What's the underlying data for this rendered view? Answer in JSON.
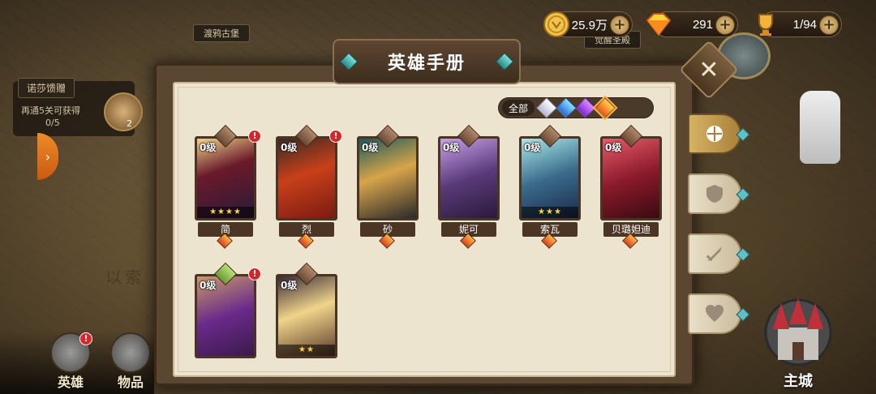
{
  "resources": {
    "gold": "25.9万",
    "gems": "291",
    "stamina": "1/94"
  },
  "map": {
    "location_crow_castle": "渡鸦古堡",
    "location_awaken_temple": "觉醒圣殿",
    "map_script": "以索"
  },
  "reward": {
    "title": "诺莎馈赠",
    "desc": "再通5关可获得",
    "progress": "0/5",
    "count": "2"
  },
  "bottom_nav": {
    "hero_label": "英雄",
    "items_label": "物品",
    "city_label": "主城"
  },
  "panel": {
    "title": "英雄手册",
    "close": "✕",
    "filter_all": "全部",
    "filter_gems": [
      "white",
      "blue",
      "purple",
      "orange"
    ],
    "selected_filter": "orange"
  },
  "heroes": [
    {
      "level": "0级",
      "name": "简",
      "stars": "★★★★",
      "alert": "!",
      "pin": "normal"
    },
    {
      "level": "0级",
      "name": "烈",
      "stars": "",
      "alert": "!",
      "pin": "normal"
    },
    {
      "level": "0级",
      "name": "砂",
      "stars": "",
      "alert": "",
      "pin": "normal"
    },
    {
      "level": "0级",
      "name": "妮可",
      "stars": "",
      "alert": "",
      "pin": "normal"
    },
    {
      "level": "0级",
      "name": "索瓦",
      "stars": "★★★",
      "alert": "",
      "pin": "normal"
    },
    {
      "level": "0级",
      "name": "贝璐妲迪",
      "stars": "",
      "alert": "",
      "pin": "normal"
    },
    {
      "level": "0级",
      "name": "",
      "stars": "",
      "alert": "!",
      "pin": "green"
    },
    {
      "level": "0级",
      "name": "",
      "stars": "★★",
      "alert": "",
      "pin": "normal"
    }
  ],
  "right_tabs": [
    "all",
    "shield",
    "sword",
    "heart"
  ],
  "colors": {
    "panel_bg": "#ede4cf",
    "frame": "#5b4632",
    "accent_gold": "#d6b264",
    "faction_orange": "#f08a2a"
  }
}
